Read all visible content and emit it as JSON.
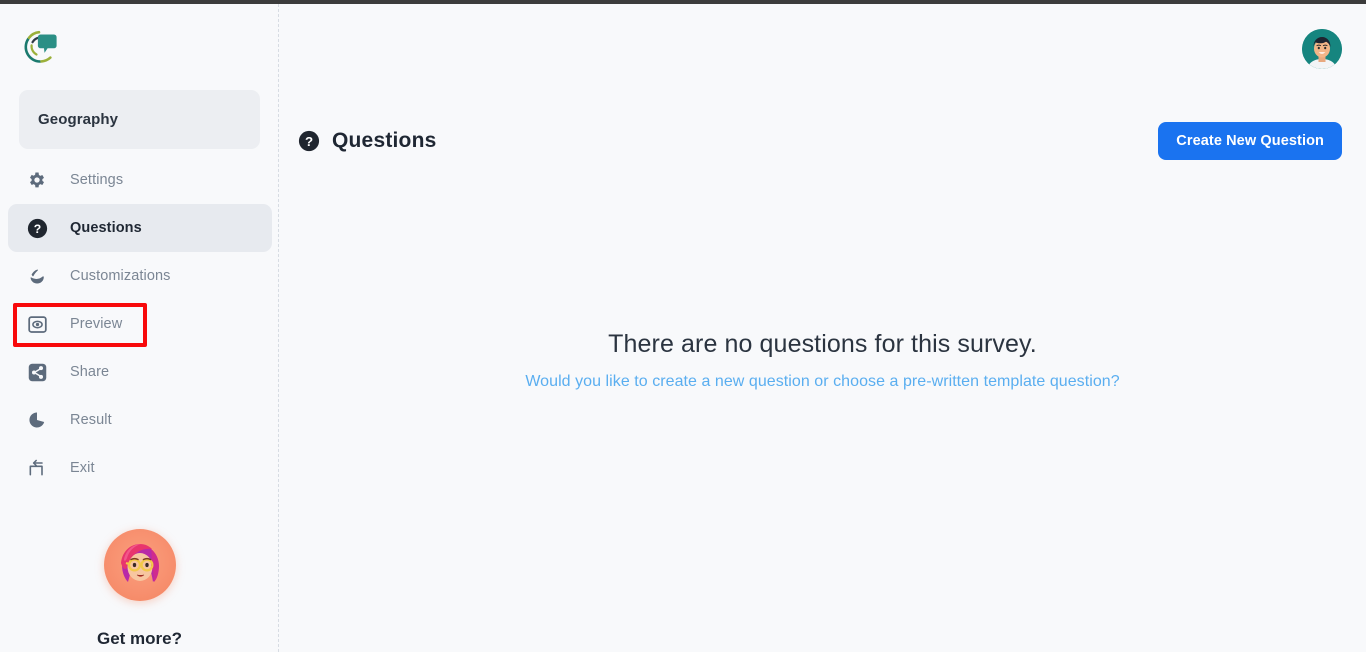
{
  "app": {
    "logo_name": "survey-logo",
    "accent_blue": "#1a73f0",
    "link_blue": "#5aaef0",
    "highlight_red": "#f8090b",
    "sidebar_bg": "#f8f9fb",
    "active_item_bg": "#e7eaef"
  },
  "sidebar": {
    "survey_name": "Geography",
    "items": [
      {
        "label": "Settings",
        "icon": "gear-icon",
        "active": false
      },
      {
        "label": "Questions",
        "icon": "question-mark-icon",
        "active": true
      },
      {
        "label": "Customizations",
        "icon": "paint-brush-icon",
        "active": false
      },
      {
        "label": "Preview",
        "icon": "eye-icon",
        "active": false
      },
      {
        "label": "Share",
        "icon": "share-icon",
        "active": false
      },
      {
        "label": "Result",
        "icon": "pie-chart-icon",
        "active": false
      },
      {
        "label": "Exit",
        "icon": "exit-icon",
        "active": false
      }
    ],
    "promo": {
      "title": "Get more?",
      "avatar_name": "promo-avatar"
    }
  },
  "header": {
    "avatar_name": "user-avatar"
  },
  "main": {
    "page_title": "Questions",
    "page_icon": "question-mark-icon",
    "create_button": "Create New Question",
    "empty_title": "There are no questions for this survey.",
    "empty_link": "Would you like to create a new question or choose a pre-written template question?"
  }
}
